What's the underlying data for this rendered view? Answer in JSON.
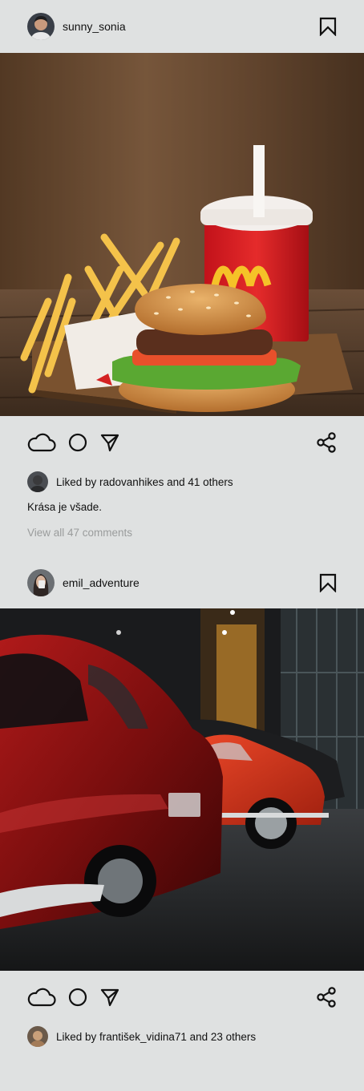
{
  "posts": [
    {
      "username": "sunny_sonia",
      "avatar_icon": "user-avatar-photo",
      "image_desc": "burger-fries-drink-photo",
      "liked_by_text": "Liked by radovanhikes and 41 others",
      "caption": "Krása je všade.",
      "comments_link": "View all 47 comments"
    },
    {
      "username": "emil_adventure",
      "avatar_icon": "user-avatar-photo",
      "image_desc": "vintage-cars-showroom-photo",
      "liked_by_text": "Liked by františek_vidina71 and 23 others"
    }
  ],
  "icons": {
    "like": "cloud-icon",
    "comment": "circle-icon",
    "send": "send-icon",
    "share": "share-icon",
    "bookmark": "bookmark-icon"
  },
  "colors": {
    "background": "#dfe1e1",
    "text": "#111111",
    "muted": "#9a9c9c"
  }
}
